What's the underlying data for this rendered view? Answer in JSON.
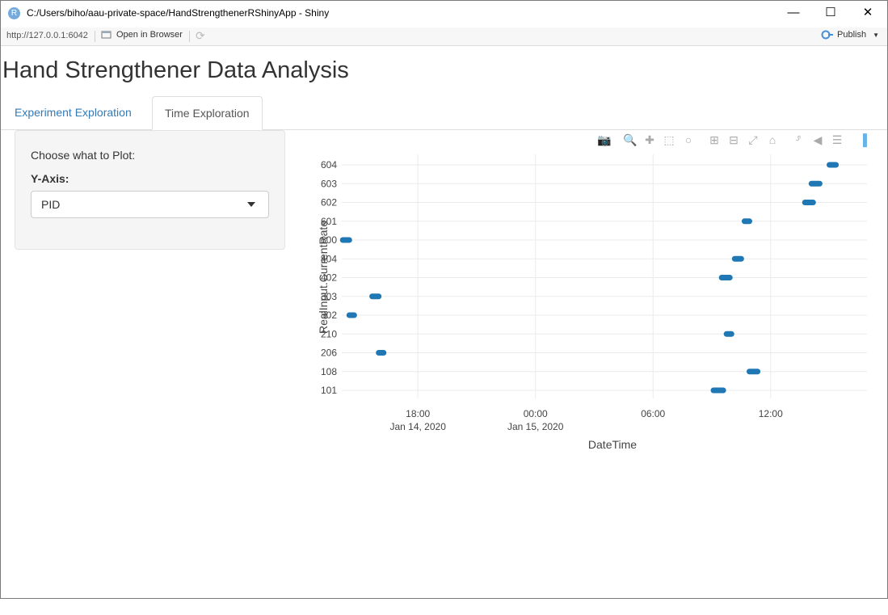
{
  "window": {
    "title": "C:/Users/biho/aau-private-space/HandStrengthenerRShinyApp - Shiny",
    "app_icon": "R",
    "minimize_icon": "minimize-icon",
    "maximize_icon": "maximize-icon",
    "close_icon": "close-icon"
  },
  "toolbar": {
    "url": "http://127.0.0.1:6042",
    "open_in_browser": "Open in Browser",
    "publish": "Publish"
  },
  "page": {
    "title": "Hand Strengthener Data Analysis",
    "tabs": [
      {
        "label": "Experiment Exploration",
        "active": false
      },
      {
        "label": "Time Exploration",
        "active": true
      }
    ]
  },
  "sidebar": {
    "heading": "Choose what to Plot:",
    "y_axis_label": "Y-Axis:",
    "y_axis_value": "PID"
  },
  "modebar": [
    "camera-icon",
    "zoom-icon",
    "pan-icon",
    "box-select-icon",
    "lasso-icon",
    "zoom-in-icon",
    "zoom-out-icon",
    "autoscale-icon",
    "reset-axes-icon",
    "spike-lines-icon",
    "hover-closest-icon",
    "hover-compare-icon",
    "plotly-logo-icon"
  ],
  "colors": {
    "marker": "#1f77b4",
    "link": "#337ab7",
    "plotly_logo": "#69b3e7"
  },
  "chart_data": {
    "type": "scatter",
    "xlabel": "DateTime",
    "ylabel": "RealInput.CurrentRate",
    "categories": [
      "101",
      "108",
      "206",
      "210",
      "302",
      "303",
      "402",
      "404",
      "600",
      "601",
      "602",
      "603",
      "604"
    ],
    "x_ticks": [
      {
        "label": "18:00",
        "sub": "Jan 14, 2020"
      },
      {
        "label": "00:00",
        "sub": "Jan 15, 2020"
      },
      {
        "label": "06:00",
        "sub": ""
      },
      {
        "label": "12:00",
        "sub": ""
      }
    ],
    "xlim": [
      "2020-01-14 14:07",
      "2020-01-15 16:55"
    ],
    "series": [
      {
        "values": [
          {
            "y": "101",
            "x_start": "2020-01-15 09:05",
            "x_end": "2020-01-15 09:35"
          },
          {
            "y": "108",
            "x_start": "2020-01-15 10:55",
            "x_end": "2020-01-15 11:20"
          },
          {
            "y": "206",
            "x_start": "2020-01-14 16:00",
            "x_end": "2020-01-14 16:15"
          },
          {
            "y": "210",
            "x_start": "2020-01-15 09:45",
            "x_end": "2020-01-15 10:00"
          },
          {
            "y": "302",
            "x_start": "2020-01-14 14:30",
            "x_end": "2020-01-14 14:45"
          },
          {
            "y": "303",
            "x_start": "2020-01-14 15:40",
            "x_end": "2020-01-14 16:00"
          },
          {
            "y": "402",
            "x_start": "2020-01-15 09:30",
            "x_end": "2020-01-15 09:55"
          },
          {
            "y": "404",
            "x_start": "2020-01-15 10:10",
            "x_end": "2020-01-15 10:30"
          },
          {
            "y": "600",
            "x_start": "2020-01-14 14:10",
            "x_end": "2020-01-14 14:30"
          },
          {
            "y": "601",
            "x_start": "2020-01-15 10:40",
            "x_end": "2020-01-15 10:55"
          },
          {
            "y": "602",
            "x_start": "2020-01-15 13:45",
            "x_end": "2020-01-15 14:10"
          },
          {
            "y": "603",
            "x_start": "2020-01-15 14:05",
            "x_end": "2020-01-15 14:30"
          },
          {
            "y": "604",
            "x_start": "2020-01-15 15:00",
            "x_end": "2020-01-15 15:20"
          }
        ]
      }
    ]
  }
}
